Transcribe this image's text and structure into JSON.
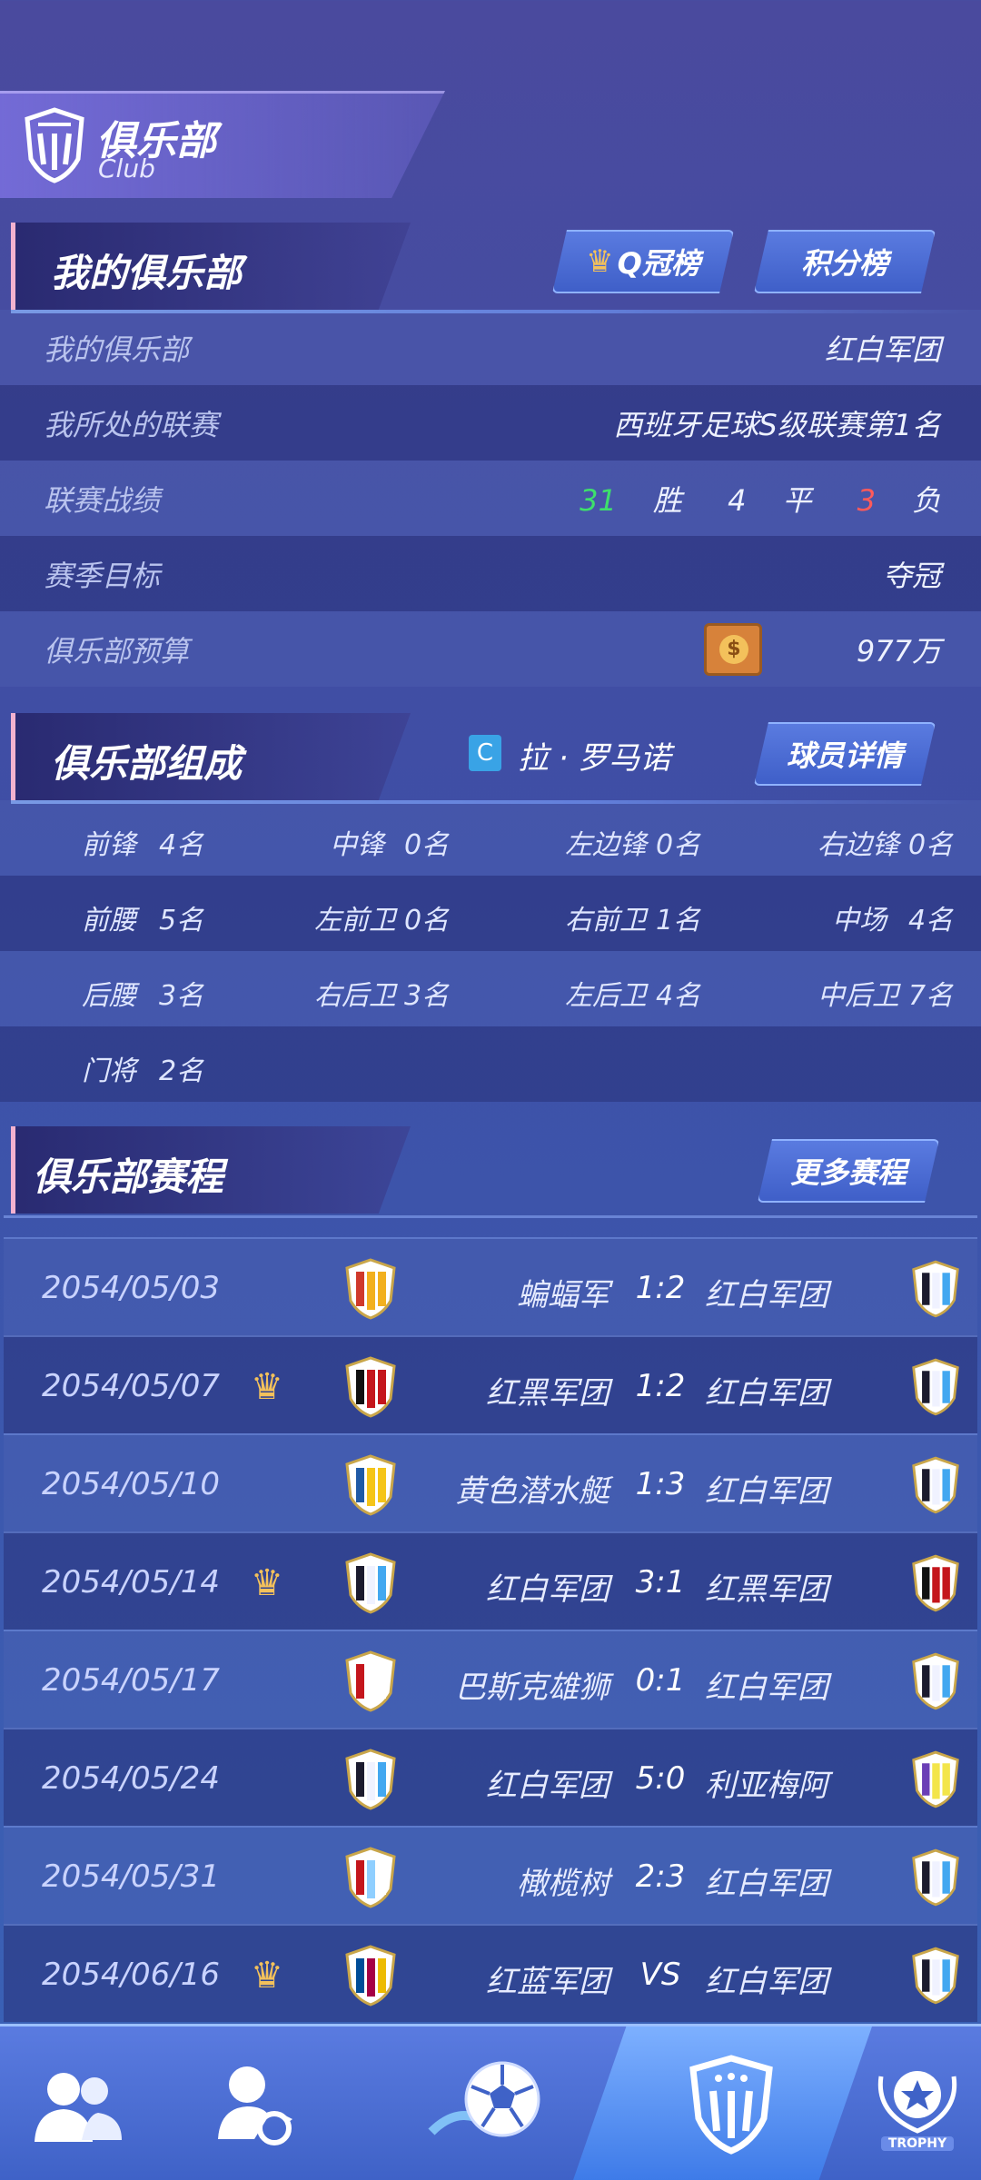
{
  "header": {
    "title": "俱乐部",
    "subtitle": "Club"
  },
  "my_club": {
    "section_title": "我的俱乐部",
    "btn_qcrown": "Q冠榜",
    "btn_points": "积分榜",
    "rows": {
      "club_label": "我的俱乐部",
      "club_value": "红白军团",
      "league_label": "我所处的联赛",
      "league_value": "西班牙足球S级联赛第1名",
      "record_label": "联赛战绩",
      "wins": "31",
      "win_label": "胜",
      "draws": "4",
      "draw_label": "平",
      "losses": "3",
      "loss_label": "负",
      "goal_label": "赛季目标",
      "goal_value": "夺冠",
      "budget_label": "俱乐部预算",
      "budget_value": "977万"
    }
  },
  "composition": {
    "section_title": "俱乐部组成",
    "coach_badge": "C",
    "coach_name": "拉 · 罗马诺",
    "btn_details": "球员详情",
    "rows": [
      [
        "前锋",
        "4名",
        "中锋",
        "0名",
        "左边锋",
        "0名",
        "右边锋",
        "0名"
      ],
      [
        "前腰",
        "5名",
        "左前卫",
        "0名",
        "右前卫",
        "1名",
        "中场",
        "4名"
      ],
      [
        "后腰",
        "3名",
        "右后卫",
        "3名",
        "左后卫",
        "4名",
        "中后卫",
        "7名"
      ],
      [
        "门将",
        "2名"
      ]
    ]
  },
  "schedule": {
    "section_title": "俱乐部赛程",
    "btn_more": "更多赛程",
    "matches": [
      {
        "date": "2054/05/03",
        "crown": false,
        "home": "蝙蝠军",
        "score": "1:2",
        "away": "红白军团"
      },
      {
        "date": "2054/05/07",
        "crown": true,
        "home": "红黑军团",
        "score": "1:2",
        "away": "红白军团"
      },
      {
        "date": "2054/05/10",
        "crown": false,
        "home": "黄色潜水艇",
        "score": "1:3",
        "away": "红白军团"
      },
      {
        "date": "2054/05/14",
        "crown": true,
        "home": "红白军团",
        "score": "3:1",
        "away": "红黑军团"
      },
      {
        "date": "2054/05/17",
        "crown": false,
        "home": "巴斯克雄狮",
        "score": "0:1",
        "away": "红白军团"
      },
      {
        "date": "2054/05/24",
        "crown": false,
        "home": "红白军团",
        "score": "5:0",
        "away": "利亚梅阿"
      },
      {
        "date": "2054/05/31",
        "crown": false,
        "home": "橄榄树",
        "score": "2:3",
        "away": "红白军团"
      },
      {
        "date": "2054/06/16",
        "crown": true,
        "home": "红蓝军团",
        "score": "VS",
        "away": "红白军团"
      }
    ]
  },
  "bottom_nav": {
    "items": [
      "team-icon",
      "player-transfer-icon",
      "football-icon",
      "club-icon",
      "trophy-icon"
    ],
    "trophy_text": "TROPHY"
  }
}
